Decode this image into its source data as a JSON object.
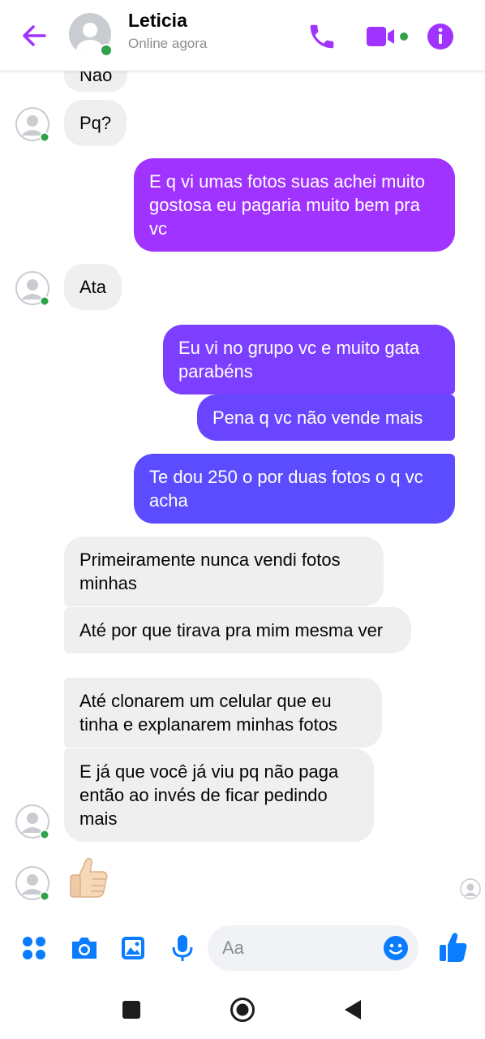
{
  "header": {
    "back_icon": "back-arrow-icon",
    "contact_name": "Leticia",
    "status": "Online agora",
    "call_icon": "phone-icon",
    "video_icon": "video-camera-icon",
    "info_icon": "info-icon"
  },
  "messages": [
    {
      "from": "them",
      "text": "Nao"
    },
    {
      "from": "them",
      "text": "Pq?"
    },
    {
      "from": "me",
      "text": "E q vi umas fotos suas achei muito gostosa eu pagaria muito bem pra vc"
    },
    {
      "from": "them",
      "text": "Ata"
    },
    {
      "from": "me",
      "text": "Eu vi no grupo vc e muito gata parabéns"
    },
    {
      "from": "me",
      "text": "Pena q vc não vende mais"
    },
    {
      "from": "me",
      "text": "Te dou 250 o por duas fotos o q vc acha"
    },
    {
      "from": "them",
      "text": "Primeiramente nunca vendi fotos minhas"
    },
    {
      "from": "them",
      "text": "Até por que tirava pra mim mesma ver"
    },
    {
      "from": "them",
      "text": "Até clonarem um celular que eu tinha e explanarem minhas fotos"
    },
    {
      "from": "them",
      "text": "E já que você já viu pq não paga então ao invés de ficar pedindo mais"
    },
    {
      "from": "them",
      "emoji": "thumbs-up"
    }
  ],
  "composer": {
    "placeholder": "Aa",
    "icons": [
      "apps-grid-icon",
      "camera-icon",
      "gallery-icon",
      "microphone-icon",
      "emoji-icon",
      "thumbs-up-icon"
    ]
  },
  "navbar": {
    "icons": [
      "recents-square-icon",
      "home-circle-icon",
      "back-triangle-icon"
    ]
  },
  "colors": {
    "accent": "#a033ff",
    "online": "#31a24c",
    "like_blue": "#0a7cff",
    "incoming_bubble": "#efefef",
    "outgoing_gradient": [
      "#a033ff",
      "#5b4dff"
    ]
  }
}
